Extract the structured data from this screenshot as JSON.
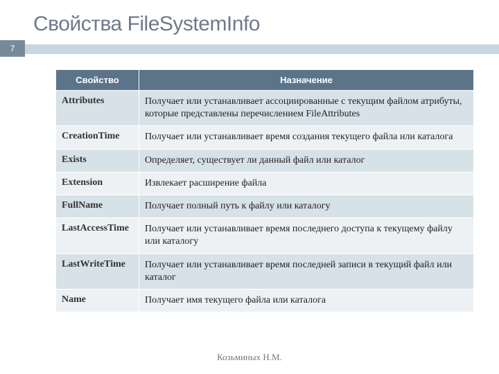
{
  "title": "Свойства FileSystemInfo",
  "page_number": "7",
  "table": {
    "headers": {
      "col1": "Свойство",
      "col2": "Назначение"
    },
    "rows": [
      {
        "prop": "Attributes",
        "desc": "Получает или устанавливает ассоциированные с текущим файлом атрибуты, которые представлены перечислением FileAttributes"
      },
      {
        "prop": "CreationTime",
        "desc": "Получает или устанавливает время создания текущего файла или каталога"
      },
      {
        "prop": "Exists",
        "desc": "Определяет, существует ли данный файл или каталог"
      },
      {
        "prop": "Extension",
        "desc": "Извлекает расширение файла"
      },
      {
        "prop": "FullName",
        "desc": "Получает полный путь к файлу или каталогу"
      },
      {
        "prop": "LastAccessTime",
        "desc": "Получает или устанавливает время последнего доступа к текущему файлу или каталогу"
      },
      {
        "prop": "LastWriteTime",
        "desc": "Получает или устанавливает время последней записи в текущий файл или каталог"
      },
      {
        "prop": "Name",
        "desc": "Получает имя текущего файла или каталога"
      }
    ]
  },
  "footer": "Козьминых Н.М."
}
